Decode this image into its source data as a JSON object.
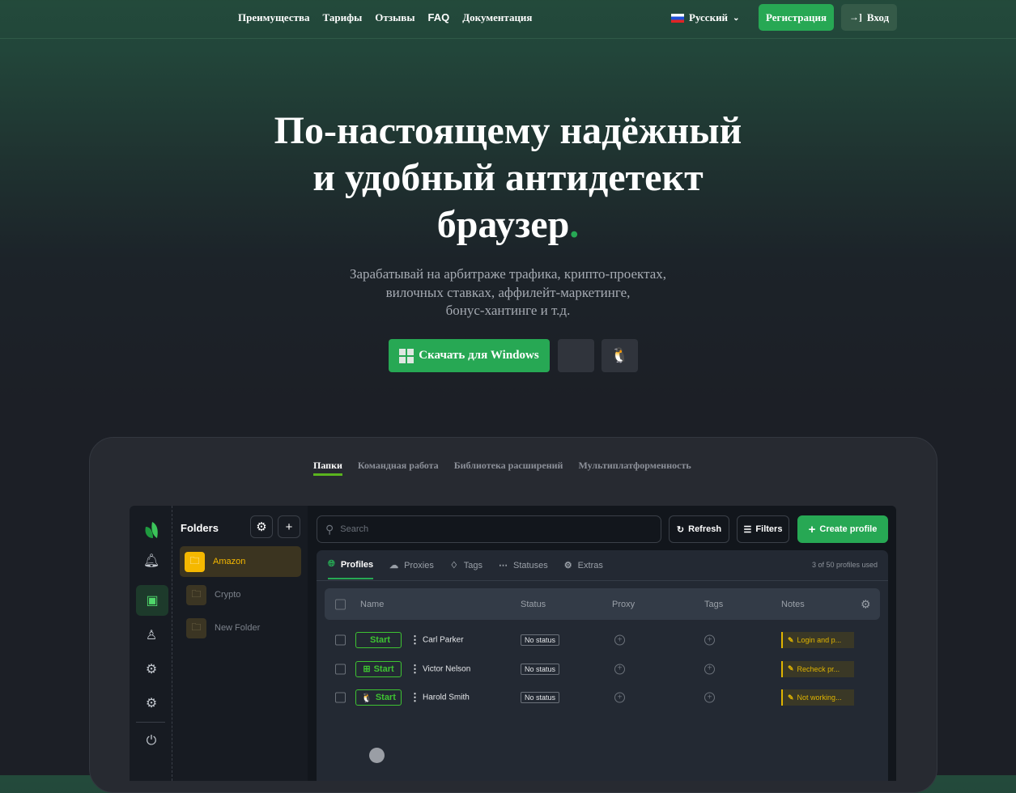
{
  "nav": {
    "links": [
      "Преимущества",
      "Тарифы",
      "Отзывы",
      "FAQ",
      "Документация"
    ],
    "language": "Русский",
    "register": "Регистрация",
    "login": "Вход"
  },
  "hero": {
    "title_lines": [
      "По-настоящему надёжный",
      "и удобный антидетект",
      "браузер"
    ],
    "title_dot": ".",
    "subtitle_lines": [
      "Зарабатывай на арбитраже трафика, крипто-проектах,",
      "вилочных ставках, аффилейт-маркетинге,",
      "бонус-хантинге и т.д."
    ],
    "download_windows": "Скачать для Windows"
  },
  "showcase": {
    "tabs": [
      "Папки",
      "Командная работа",
      "Библиотека расширений",
      "Мультиплатформенность"
    ],
    "active_tab": "Папки"
  },
  "app": {
    "folders_title": "Folders",
    "folders": [
      {
        "name": "Amazon",
        "active": true
      },
      {
        "name": "Crypto"
      },
      {
        "name": "New Folder"
      }
    ],
    "search_placeholder": "Search",
    "refresh": "Refresh",
    "filters": "Filters",
    "create_profile": "Create profile",
    "tabs": [
      "Profiles",
      "Proxies",
      "Tags",
      "Statuses",
      "Extras"
    ],
    "active_tab": "Profiles",
    "usage": "3 of 50 profiles used",
    "columns": [
      "Name",
      "Status",
      "Proxy",
      "Tags",
      "Notes"
    ],
    "rows": [
      {
        "os": "macos",
        "start": "Start",
        "name": "Carl Parker",
        "status": "No status",
        "note": "Login and p..."
      },
      {
        "os": "windows",
        "start": "Start",
        "name": "Victor Nelson",
        "status": "No status",
        "note": "Recheck pr..."
      },
      {
        "os": "linux",
        "start": "Start",
        "name": "Harold Smith",
        "status": "No status",
        "note": "Not working..."
      }
    ]
  },
  "colors": {
    "accent": "#27a854",
    "folder_accent": "#f5b800",
    "note": "#e0b400"
  }
}
